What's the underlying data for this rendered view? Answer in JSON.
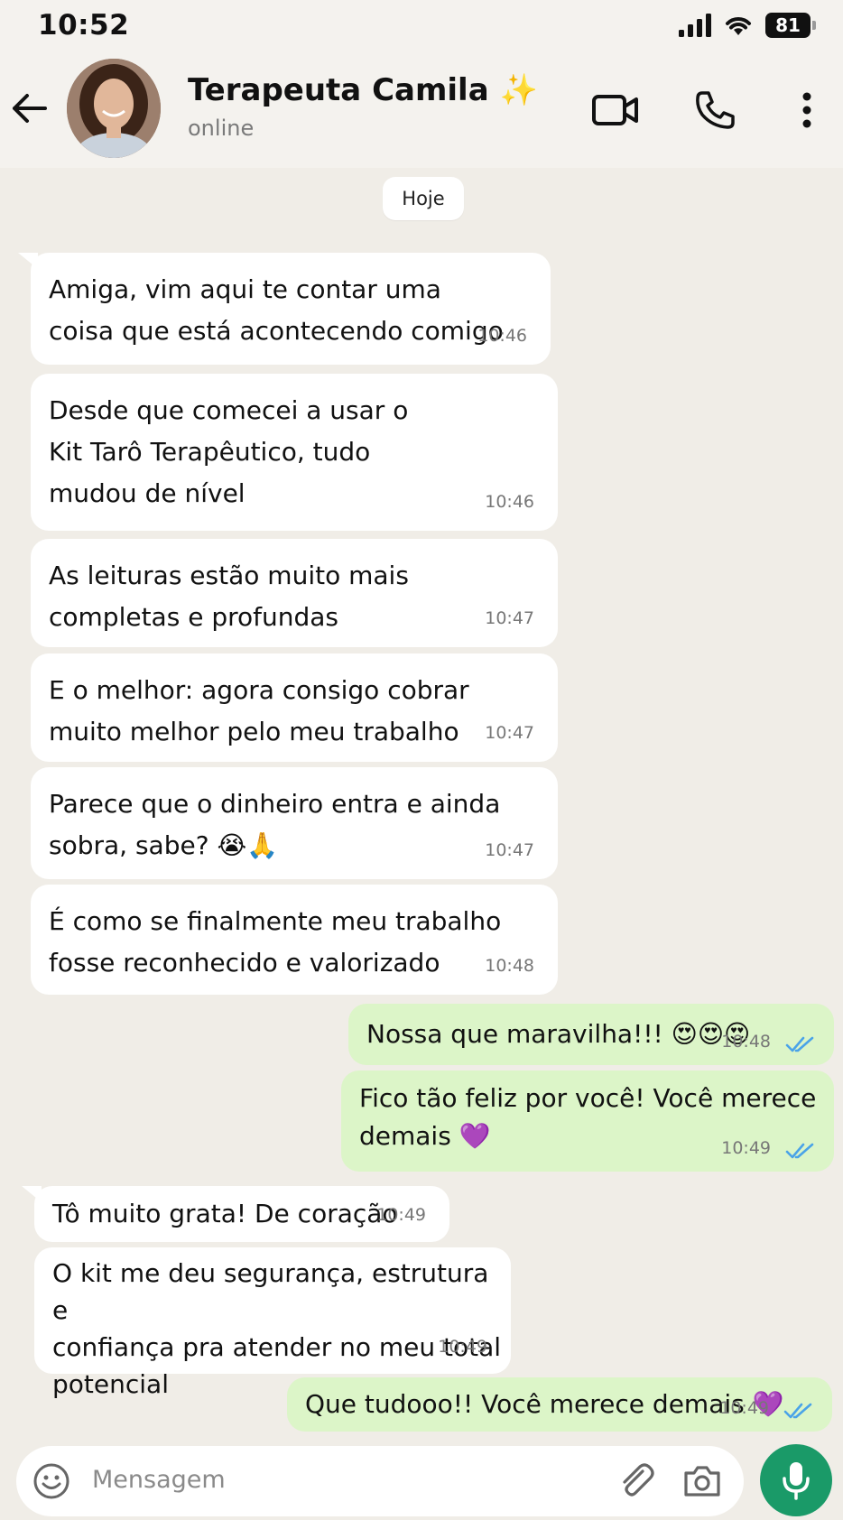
{
  "status_bar": {
    "time": "10:52",
    "battery": "81"
  },
  "header": {
    "contact_name": "Terapeuta Camila ✨",
    "status": "online"
  },
  "date_chip": "Hoje",
  "messages": [
    {
      "dir": "in",
      "text": "Amiga, vim aqui te contar uma\ncoisa que está acontecendo comigo",
      "time": "10:46"
    },
    {
      "dir": "in",
      "text": "Desde que comecei a usar o\nKit Tarô Terapêutico, tudo\nmudou de nível",
      "time": "10:46"
    },
    {
      "dir": "in",
      "text": "As leituras estão muito mais\ncompletas e profundas",
      "time": "10:47"
    },
    {
      "dir": "in",
      "text": "E o melhor: agora consigo cobrar\nmuito melhor pelo meu trabalho",
      "time": "10:47"
    },
    {
      "dir": "in",
      "text": "Parece que o dinheiro entra e ainda\nsobra, sabe? 😭🙏",
      "time": "10:47"
    },
    {
      "dir": "in",
      "text": "É como se finalmente meu trabalho\nfosse reconhecido e valorizado",
      "time": "10:48"
    },
    {
      "dir": "out",
      "text": "Nossa que maravilha!!! 😍😍😍",
      "time": "10:48"
    },
    {
      "dir": "out",
      "text": "Fico tão feliz por você! Você merece\ndemais 💜",
      "time": "10:49"
    },
    {
      "dir": "in",
      "text": "Tô muito grata! De coração",
      "time": "10:49"
    },
    {
      "dir": "in",
      "text": "O kit me deu segurança, estrutura e\nconfiança pra atender no meu total\npotencial",
      "time": "10:49"
    },
    {
      "dir": "out",
      "text": "Que tudooo!! Você merece demais 💜",
      "time": "10:49"
    }
  ],
  "composer": {
    "placeholder": "Mensagem"
  },
  "colors": {
    "incoming": "#ffffff",
    "outgoing": "#dcf5c8",
    "accent": "#1a9a68",
    "read_ticks": "#4aa3e8"
  },
  "icons": [
    "back-arrow-icon",
    "video-call-icon",
    "phone-icon",
    "more-options-icon",
    "emoji-icon",
    "attach-icon",
    "camera-icon",
    "mic-icon",
    "double-check-icon"
  ]
}
